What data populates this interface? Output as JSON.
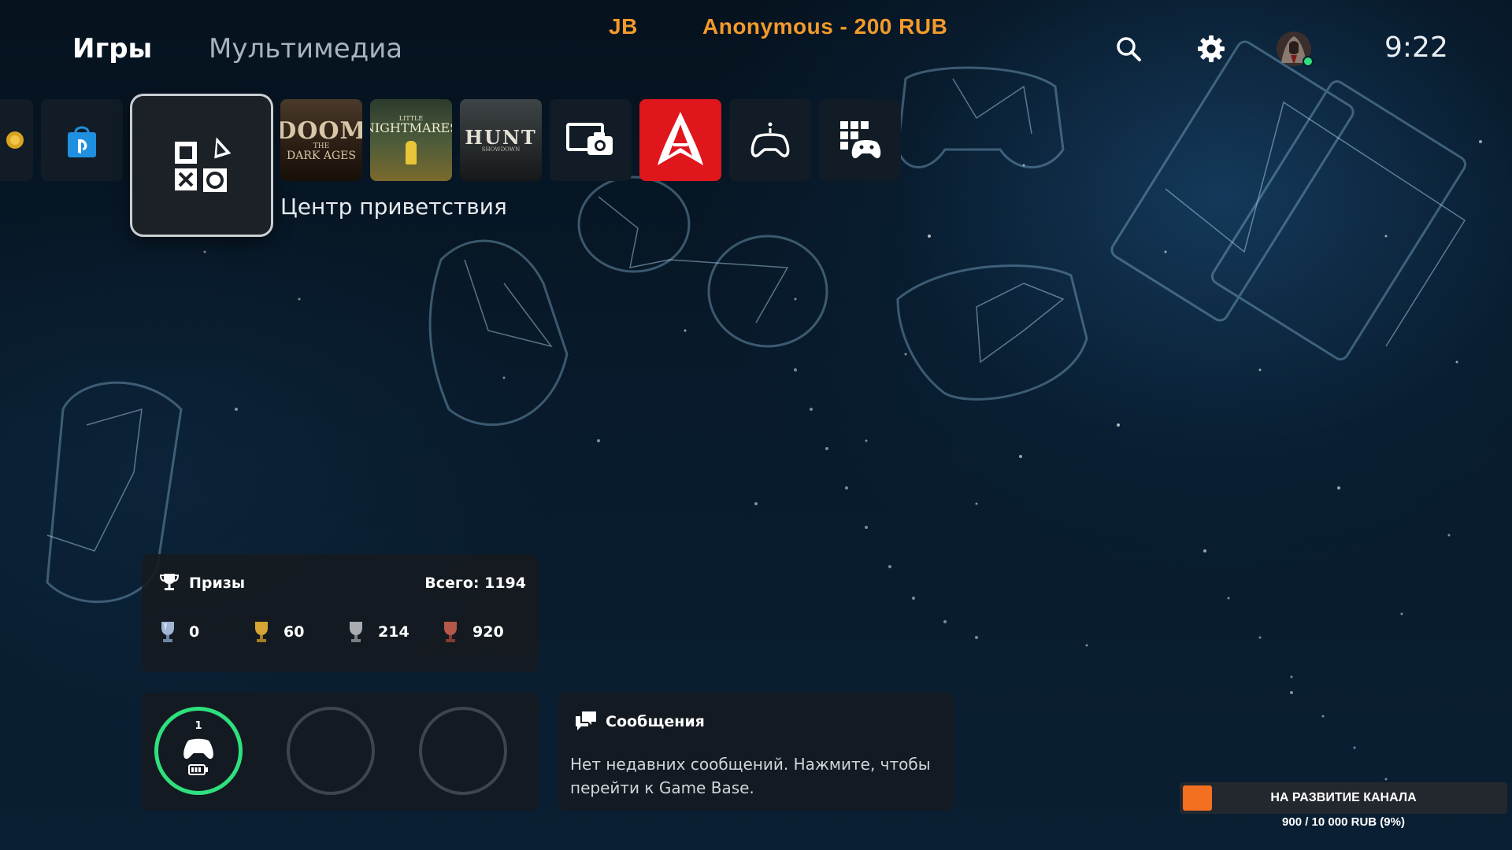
{
  "header": {
    "tabs": [
      {
        "label": "Игры",
        "active": true
      },
      {
        "label": "Мультимедиа",
        "active": false
      }
    ],
    "clock": "9:22",
    "icons": [
      "search-icon",
      "gear-icon",
      "avatar"
    ],
    "online_color": "#2ee07e"
  },
  "stream_overlay": {
    "left_text": "JB",
    "donor_text": "Anonymous - 200 RUB",
    "color": "#f39a2b"
  },
  "games_row": {
    "selected_label": "Центр приветствия",
    "tiles": [
      {
        "name": "partial-tile",
        "icon": "coin-icon"
      },
      {
        "name": "playstation-store",
        "icon": "ps-store-bag-icon"
      },
      {
        "name": "game-hub",
        "icon": "ps-shapes-icon",
        "selected": true
      },
      {
        "name": "doom-the-dark-ages",
        "art_text": [
          "DOOM",
          "THE",
          "DARK AGES"
        ]
      },
      {
        "name": "little-nightmares",
        "art_text": [
          "LITTLE",
          "NIGHTMARES"
        ]
      },
      {
        "name": "hunt-showdown",
        "art_text": [
          "HUNT",
          "SHOWDOWN"
        ]
      },
      {
        "name": "media-gallery",
        "icon": "gallery-camera-icon"
      },
      {
        "name": "assassins-creed-shadows",
        "icon": "assassin-emblem-icon",
        "accent": "#e0161d"
      },
      {
        "name": "accessories",
        "icon": "controller-icon"
      },
      {
        "name": "game-library",
        "icon": "library-grid-icon"
      }
    ]
  },
  "trophies": {
    "title": "Призы",
    "total": "Всего: 1194",
    "counts": {
      "platinum": "0",
      "gold": "60",
      "silver": "214",
      "bronze": "920"
    }
  },
  "controllers": {
    "slot1_number": "1",
    "slots": 3,
    "battery_icon": "battery-icon"
  },
  "messages": {
    "title": "Сообщения",
    "body": "Нет недавних сообщений. Нажмите, чтобы перейти к Game Base."
  },
  "donation": {
    "label": "НА РАЗВИТИЕ КАНАЛА",
    "progress_text": "900 / 10 000 RUB (9%)",
    "progress_fraction": 0.09,
    "fill_color": "#f2701f"
  }
}
